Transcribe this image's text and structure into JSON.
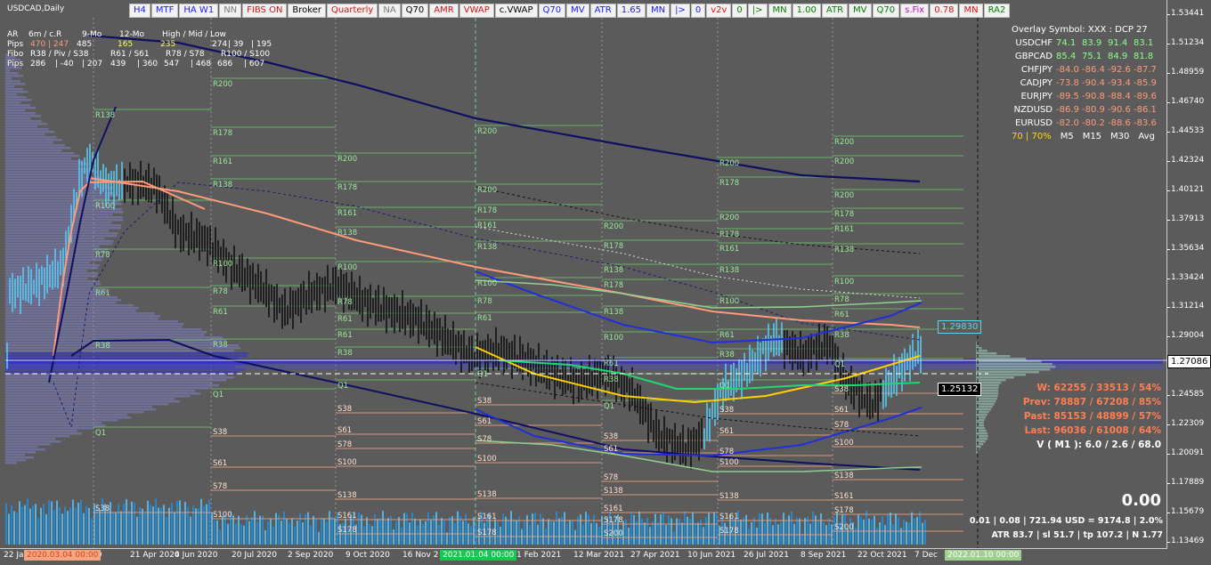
{
  "window": {
    "symbol_title": "USDCAD,Daily"
  },
  "toolbar": [
    {
      "label": "H4",
      "color": "#1a1aff"
    },
    {
      "label": "MTF",
      "color": "#1a1aff"
    },
    {
      "label": "HA W1",
      "color": "#1a1aff"
    },
    {
      "label": "NN",
      "color": "#7a7a7a"
    },
    {
      "label": "FIBS ON",
      "color": "#e01010"
    },
    {
      "label": "Broker",
      "color": "#000000"
    },
    {
      "label": "Quarterly",
      "color": "#e01010"
    },
    {
      "label": "NA",
      "color": "#7a7a7a"
    },
    {
      "label": "Q70",
      "color": "#000000"
    },
    {
      "label": "AMR",
      "color": "#e01010"
    },
    {
      "label": "VWAP",
      "color": "#e01010"
    },
    {
      "label": "c.VWAP",
      "color": "#000000"
    },
    {
      "label": "Q70",
      "color": "#1a1aff"
    },
    {
      "label": "MV",
      "color": "#1a1aff"
    },
    {
      "label": "ATR",
      "color": "#1a1aff"
    },
    {
      "label": "1.65",
      "color": "#1a1aff"
    },
    {
      "label": "MN",
      "color": "#1a1aff"
    },
    {
      "label": "|>",
      "color": "#1a1aff"
    },
    {
      "label": "0",
      "color": "#1a1aff"
    },
    {
      "label": "v2v",
      "color": "#e01010"
    },
    {
      "label": "0",
      "color": "#008000"
    },
    {
      "label": "|>",
      "color": "#008000"
    },
    {
      "label": "MN",
      "color": "#008000"
    },
    {
      "label": "1.00",
      "color": "#008000"
    },
    {
      "label": "ATR",
      "color": "#008000"
    },
    {
      "label": "MV",
      "color": "#008000"
    },
    {
      "label": "Q70",
      "color": "#008000"
    },
    {
      "label": "s.Fix",
      "color": "#d000d0"
    },
    {
      "label": "0.78",
      "color": "#e01010"
    },
    {
      "label": "MN",
      "color": "#e01010"
    },
    {
      "label": "RA2",
      "color": "#008000"
    }
  ],
  "stats": {
    "row1": [
      "AR",
      "6m / c.R",
      "9-Mo",
      "12-Mo",
      "High / Mid / Low"
    ],
    "row2_label": "Pips",
    "row2": [
      {
        "v": "470",
        "c": "#ff9a7a"
      },
      {
        "v": "| 247",
        "c": "#ff9a7a"
      },
      {
        "v": "485",
        "c": "#ffffff"
      },
      {
        "v": "165",
        "c": "#ffff66"
      },
      {
        "v": "235",
        "c": "#ffff66"
      },
      {
        "v": "274",
        "c": "#ffffff"
      },
      {
        "v": "| 39",
        "c": "#ffffff"
      },
      {
        "v": "| 195",
        "c": "#ffffff"
      }
    ],
    "row3": [
      "Fibo",
      "R38 / Piv / S38",
      "R61 / S61",
      "R78 / S78",
      "R100 / S100"
    ],
    "row4_label": "Pips",
    "row4": [
      "286",
      "| -40",
      "| 207",
      "439",
      "| 360",
      "547",
      "| 468",
      "686",
      "| 607"
    ]
  },
  "overlay": {
    "title": "Overlay Symbol: XXX : DCP 27",
    "rows": [
      {
        "sym": "USDCHF",
        "vals": [
          "74.1",
          "83.9",
          "91.4",
          "83.1"
        ],
        "color": "#8cff8c"
      },
      {
        "sym": "GBPCAD",
        "vals": [
          "85.4",
          "75.1",
          "84.9",
          "81.8"
        ],
        "color": "#8cff8c"
      },
      {
        "sym": "CHFJPY",
        "vals": [
          "-84.0",
          "-86.4",
          "-92.6",
          "-87.7"
        ],
        "color": "#ff9a7a"
      },
      {
        "sym": "CADJPY",
        "vals": [
          "-73.8",
          "-90.4",
          "-93.4",
          "-85.9"
        ],
        "color": "#ff9a7a"
      },
      {
        "sym": "EURJPY",
        "vals": [
          "-89.5",
          "-90.8",
          "-88.4",
          "-89.6"
        ],
        "color": "#ff9a7a"
      },
      {
        "sym": "NZDUSD",
        "vals": [
          "-86.9",
          "-80.9",
          "-90.6",
          "-86.1"
        ],
        "color": "#ff9a7a"
      },
      {
        "sym": "EURUSD",
        "vals": [
          "-82.0",
          "-80.2",
          "-88.6",
          "-83.6"
        ],
        "color": "#ff9a7a"
      }
    ],
    "footer": {
      "pct": "70 | 70%",
      "pct_color": "#ffd700",
      "tfs": [
        "M5",
        "M15",
        "M30",
        "Avg"
      ]
    }
  },
  "performance": [
    {
      "text": "W: 62255 / 33513 / 54%",
      "color": "#ff7f50"
    },
    {
      "text": "Prev: 78887 / 67208 / 85%",
      "color": "#ff7f50"
    },
    {
      "text": "Past: 85153 / 48899 / 57%",
      "color": "#ff7f50"
    },
    {
      "text": "Last: 96036 / 61008 / 64%",
      "color": "#ff7f50"
    },
    {
      "text": "V ( M1 ): 6.0 / 2.6 / 68.0",
      "color": "#ffffff"
    }
  ],
  "big_number": "0.00",
  "bottom_stats": {
    "line1": "0.01  |  0.08  |  721.94 USD = 9174.8  |  2.0%",
    "line2": "ATR 83.7  |  sl 51.7  |  tp 107.2  |  N 1.77"
  },
  "price_axis": [
    "1.53441",
    "1.51234",
    "1.48959",
    "1.46740",
    "1.44533",
    "1.42324",
    "1.40121",
    "1.37913",
    "1.35634",
    "1.33424",
    "1.31214",
    "1.29004",
    "1.27086",
    "1.24585",
    "1.22309",
    "1.20091",
    "1.17889",
    "1.15679",
    "1.13469"
  ],
  "price_tags": [
    {
      "text": "1.29830",
      "bg": "#5b5b5b",
      "fg": "#5bd5f0",
      "border": "#5bd5f0"
    },
    {
      "text": "1.25132",
      "bg": "#000000",
      "fg": "#ffffff",
      "border": "#ffffff"
    },
    {
      "text": "1.27086",
      "bg": "#ffffff",
      "fg": "#000000",
      "border": "#000000"
    }
  ],
  "time_axis": [
    "22 Ja",
    "20",
    "21 Apr 2020",
    "4 Jun 2020",
    "20 Jul 2020",
    "2 Sep 2020",
    "9 Oct 2020",
    "16 Nov 2",
    "1 Feb 2021",
    "12 Mar 2021",
    "27 Apr 2021",
    "10 Jun 2021",
    "26 Jul 2021",
    "8 Sep 2021",
    "22 Oct 2021",
    "7 Dec"
  ],
  "date_badges": [
    {
      "text": "2020.03.04 00:00",
      "bg": "#f4a582",
      "fg": "#e04010"
    },
    {
      "text": "2021.01.04 00:00",
      "bg": "#14c850",
      "fg": "#ffffff"
    },
    {
      "text": "2022.01.10 00:00",
      "bg": "#a0d090",
      "fg": "#ffffff"
    }
  ],
  "level_labels": {
    "green": [
      "R138",
      "R100",
      "R78",
      "R61",
      "R38",
      "Q1",
      "R178",
      "R161",
      "R138",
      "R100",
      "R78",
      "R61",
      "R38",
      "Q1",
      "R200",
      "R178",
      "R161",
      "R138",
      "R100",
      "R78",
      "R61",
      "R38",
      "Q1",
      "R200",
      "R178",
      "R161",
      "R138",
      "R100",
      "R78",
      "R61",
      "R38",
      "Q1",
      "R200",
      "R178",
      "R161",
      "R138",
      "R100",
      "R78",
      "R61",
      "R38",
      "Q1"
    ],
    "salmon": [
      "S38",
      "S61",
      "S78",
      "S100",
      "S138",
      "S161",
      "S178",
      "S200",
      "S38",
      "S61",
      "S78",
      "S100",
      "S138",
      "S161",
      "S178",
      "S200",
      "S38",
      "S61",
      "S78",
      "S100",
      "S138",
      "S161",
      "S178",
      "S200"
    ]
  }
}
